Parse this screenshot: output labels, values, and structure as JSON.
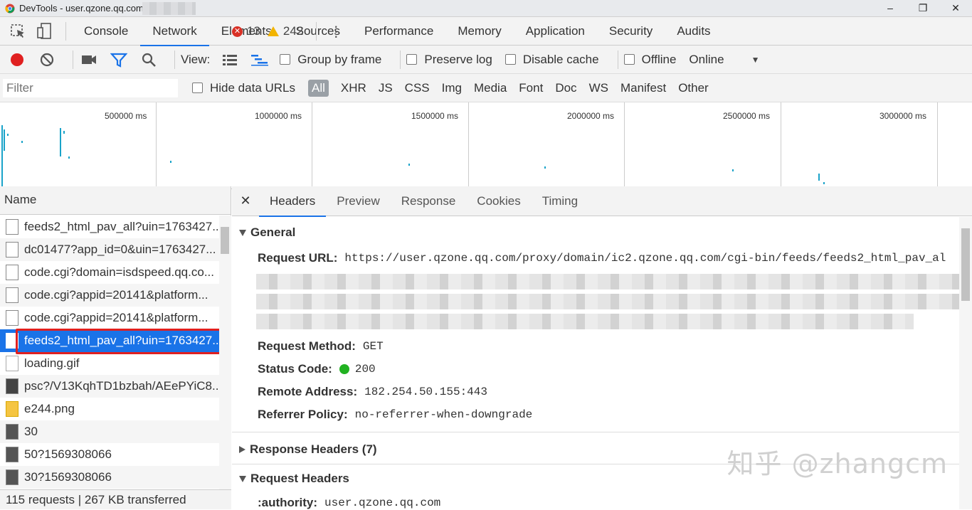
{
  "window": {
    "title": "DevTools - user.qzone.qq.com",
    "buttons": [
      "–",
      "❐",
      "✕"
    ]
  },
  "tabs": [
    "Console",
    "Network",
    "Elements",
    "Sources",
    "Performance",
    "Memory",
    "Application",
    "Security",
    "Audits"
  ],
  "active_tab": "Network",
  "errors": "13",
  "warnings": "242",
  "toolbar": {
    "view_label": "View:",
    "group_by_frame": "Group by frame",
    "preserve_log": "Preserve log",
    "disable_cache": "Disable cache",
    "offline": "Offline",
    "throttle": "Online"
  },
  "filter": {
    "placeholder": "Filter",
    "hide_data_urls": "Hide data URLs",
    "types": [
      "All",
      "XHR",
      "JS",
      "CSS",
      "Img",
      "Media",
      "Font",
      "Doc",
      "WS",
      "Manifest",
      "Other"
    ]
  },
  "overview": {
    "ticks": [
      "500000 ms",
      "1000000 ms",
      "1500000 ms",
      "2000000 ms",
      "2500000 ms",
      "3000000 ms"
    ]
  },
  "requests": {
    "header": "Name",
    "rows": [
      "feeds2_html_pav_all?uin=1763427...",
      "dc01477?app_id=0&uin=1763427...",
      "code.cgi?domain=isdspeed.qq.co...",
      "code.cgi?appid=20141&platform...",
      "code.cgi?appid=20141&platform...",
      "feeds2_html_pav_all?uin=1763427...",
      "loading.gif",
      "psc?/V13KqhTD1bzbah/AEePYiC8...",
      "e244.png",
      "30",
      "50?1569308066",
      "30?1569308066"
    ],
    "status": "115 requests  |  267 KB transferred"
  },
  "details": {
    "tabs": [
      "Headers",
      "Preview",
      "Response",
      "Cookies",
      "Timing"
    ],
    "general_title": "General",
    "request_url_label": "Request URL:",
    "request_url": "https://user.qzone.qq.com/proxy/domain/ic2.qzone.qq.com/cgi-bin/feeds/feeds2_html_pav_al",
    "request_method_label": "Request Method:",
    "request_method": "GET",
    "status_code_label": "Status Code:",
    "status_code": "200",
    "remote_address_label": "Remote Address:",
    "remote_address": "182.254.50.155:443",
    "referrer_policy_label": "Referrer Policy:",
    "referrer_policy": "no-referrer-when-downgrade",
    "response_headers_title": "Response Headers (7)",
    "request_headers_title": "Request Headers",
    "authority_label": ":authority:",
    "authority": "user.qzone.qq.com"
  },
  "watermark": "知乎 @zhangcm"
}
